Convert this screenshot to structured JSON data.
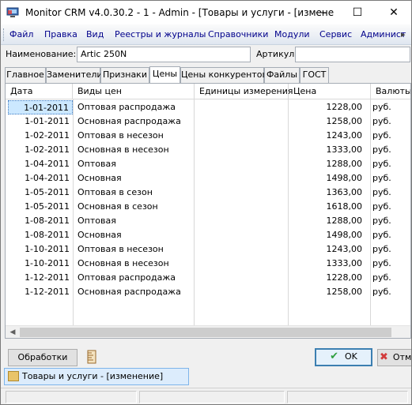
{
  "window": {
    "title": "Monitor CRM v4.0.30.2 - 1 - Admin - [Товары и услуги - [измене",
    "minimize_glyph": "—",
    "maximize_glyph": "☐",
    "close_glyph": "✕"
  },
  "menu": {
    "items": [
      "Файл",
      "Правка",
      "Вид",
      "Реестры и журналы",
      "Справочники",
      "Модули",
      "Сервис",
      "Админист"
    ],
    "more_glyph": "▸"
  },
  "fields": {
    "name_label": "Наименование:",
    "name_value": "Artic 250N",
    "article_label": "Артикул:",
    "article_value": ""
  },
  "tabs": [
    "Главное",
    "Заменители",
    "Признаки",
    "Цены",
    "Цены конкурентов",
    "Файлы",
    "ГОСТ"
  ],
  "active_tab": "Цены",
  "grid": {
    "columns": [
      "Дата",
      "Виды цен",
      "Единицы измерения",
      "Цена",
      "Валюты"
    ],
    "rows": [
      {
        "date": "1-01-2011",
        "type": "Оптовая распродажа",
        "unit": "",
        "price": "1228,00",
        "currency": "руб."
      },
      {
        "date": "1-01-2011",
        "type": "Основная распродажа",
        "unit": "",
        "price": "1258,00",
        "currency": "руб."
      },
      {
        "date": "1-02-2011",
        "type": "Оптовая в несезон",
        "unit": "",
        "price": "1243,00",
        "currency": "руб."
      },
      {
        "date": "1-02-2011",
        "type": "Основная в несезон",
        "unit": "",
        "price": "1333,00",
        "currency": "руб."
      },
      {
        "date": "1-04-2011",
        "type": "Оптовая",
        "unit": "",
        "price": "1288,00",
        "currency": "руб."
      },
      {
        "date": "1-04-2011",
        "type": "Основная",
        "unit": "",
        "price": "1498,00",
        "currency": "руб."
      },
      {
        "date": "1-05-2011",
        "type": "Оптовая в сезон",
        "unit": "",
        "price": "1363,00",
        "currency": "руб."
      },
      {
        "date": "1-05-2011",
        "type": "Основная в сезон",
        "unit": "",
        "price": "1618,00",
        "currency": "руб."
      },
      {
        "date": "1-08-2011",
        "type": "Оптовая",
        "unit": "",
        "price": "1288,00",
        "currency": "руб."
      },
      {
        "date": "1-08-2011",
        "type": "Основная",
        "unit": "",
        "price": "1498,00",
        "currency": "руб."
      },
      {
        "date": "1-10-2011",
        "type": "Оптовая в несезон",
        "unit": "",
        "price": "1243,00",
        "currency": "руб."
      },
      {
        "date": "1-10-2011",
        "type": "Основная в несезон",
        "unit": "",
        "price": "1333,00",
        "currency": "руб."
      },
      {
        "date": "1-12-2011",
        "type": "Оптовая распродажа",
        "unit": "",
        "price": "1228,00",
        "currency": "руб."
      },
      {
        "date": "1-12-2011",
        "type": "Основная распродажа",
        "unit": "",
        "price": "1258,00",
        "currency": "руб."
      }
    ],
    "scroll_left_glyph": "◀"
  },
  "actions": {
    "processing_label": "Обработки",
    "ok_label": "OK",
    "cancel_label": "Отм",
    "ok_glyph": "✔",
    "cancel_glyph": "✖"
  },
  "taskbar": {
    "item_label": "Товары и услуги - [изменение]"
  },
  "icons": {
    "app": "monitor-crm-icon",
    "tools": "ruler-icon",
    "task": "box-icon"
  },
  "colors": {
    "menu_text": "#00008b",
    "selection": "#cce8ff",
    "ok_border": "#3c7fb1",
    "ok_check": "#2e9e3e",
    "cancel_x": "#d23b3b"
  }
}
